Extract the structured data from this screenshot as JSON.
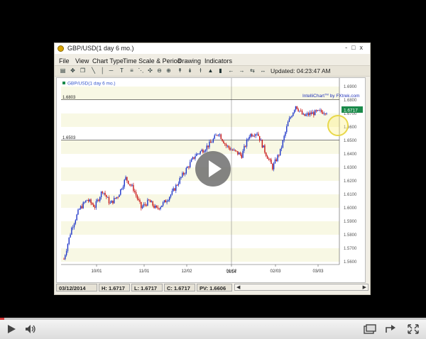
{
  "window": {
    "title": "GBP/USD(1 day  6 mo.)",
    "controls": [
      "-",
      "□",
      "x"
    ]
  },
  "menu": [
    "File",
    "View",
    "Chart Type",
    "Time Scale & Period",
    "Drawing",
    "Indicators"
  ],
  "toolbar": {
    "icons": [
      "bar-chart-icon",
      "crosshair-icon",
      "copy-icon",
      "line-tool-icon",
      "vertical-line-icon",
      "horizontal-line-icon",
      "text-tool-icon",
      "fibonacci-icon",
      "fan-icon",
      "move-icon",
      "zoom-out-icon",
      "zoom-in-icon",
      "up-arrow-icon",
      "down-arrow-icon",
      "cursor-icon",
      "indicator-icon",
      "candle-icon",
      "arrow-left-icon",
      "arrow-right-icon",
      "refresh-icon"
    ],
    "updated_label": "Updated: 04:23:47 AM"
  },
  "chart": {
    "legend": "GBP/USD(1 day  6 mo.)",
    "watermark_prefix": "IntelliChart",
    "watermark_tm": "TM",
    "watermark_suffix": " by FXtrek.com",
    "current_price_label": "1.6717",
    "level_high_label": "1.6803",
    "level_low_label": "1.6503",
    "year_label": "2014",
    "accent_colors": {
      "up": "#1c34c8",
      "down": "#c81414",
      "price_tag": "#1a8a4a"
    }
  },
  "chart_data": {
    "type": "candlestick",
    "symbol": "GBP/USD",
    "x_labels": [
      "10/01",
      "11/01",
      "12/02",
      "01/02",
      "02/03",
      "03/03"
    ],
    "y_ticks": [
      "1.6900",
      "1.6800",
      "1.6700",
      "1.6600",
      "1.6500",
      "1.6400",
      "1.6300",
      "1.6200",
      "1.6100",
      "1.6000",
      "1.5900",
      "1.5800",
      "1.5700",
      "1.5600"
    ],
    "ylim": [
      1.56,
      1.69
    ],
    "horizontal_levels": [
      1.6803,
      1.6503
    ],
    "last_price": 1.6717,
    "close_path": [
      [
        0,
        1.562
      ],
      [
        6,
        1.585
      ],
      [
        12,
        1.599
      ],
      [
        18,
        1.606
      ],
      [
        24,
        1.601
      ],
      [
        30,
        1.613
      ],
      [
        36,
        1.603
      ],
      [
        42,
        1.609
      ],
      [
        48,
        1.622
      ],
      [
        54,
        1.614
      ],
      [
        60,
        1.6
      ],
      [
        66,
        1.605
      ],
      [
        72,
        1.599
      ],
      [
        78,
        1.604
      ],
      [
        84,
        1.611
      ],
      [
        90,
        1.621
      ],
      [
        96,
        1.63
      ],
      [
        102,
        1.639
      ],
      [
        108,
        1.643
      ],
      [
        114,
        1.648
      ],
      [
        120,
        1.656
      ],
      [
        126,
        1.646
      ],
      [
        132,
        1.642
      ],
      [
        138,
        1.639
      ],
      [
        144,
        1.654
      ],
      [
        150,
        1.656
      ],
      [
        156,
        1.642
      ],
      [
        162,
        1.63
      ],
      [
        168,
        1.642
      ],
      [
        174,
        1.663
      ],
      [
        180,
        1.676
      ],
      [
        186,
        1.668
      ],
      [
        192,
        1.67
      ],
      [
        198,
        1.671
      ],
      [
        204,
        1.6717
      ]
    ]
  },
  "status": [
    {
      "label": "03/12/2014"
    },
    {
      "label": "H: 1.6717"
    },
    {
      "label": "L: 1.6717"
    },
    {
      "label": "C: 1.6717"
    },
    {
      "label": "PV: 1.6606"
    }
  ],
  "player": {
    "progress": 0.01,
    "controls": [
      "play-icon",
      "volume-icon",
      "captions-icon",
      "share-icon",
      "fullscreen-icon"
    ]
  }
}
